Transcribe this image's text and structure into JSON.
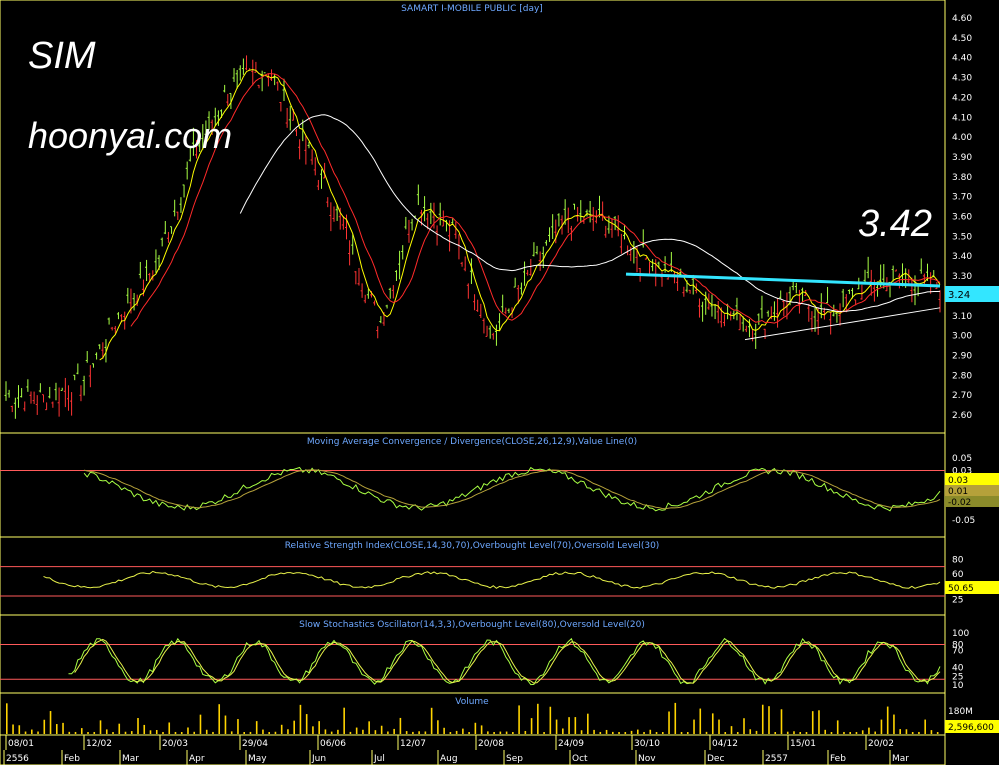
{
  "symbol_overlay": "SIM",
  "site_overlay": "hoonyai.com",
  "price_overlay": "3.42",
  "colors": {
    "background": "#000000",
    "panel_border": "#ffff66",
    "title_text": "#6ea8ff",
    "axis_text": "#ffffff",
    "candles": "#a8ff44",
    "candles_down": "#ff3333",
    "ma_fast": "#ffff00",
    "ma_mid": "#ff2a2a",
    "ma_slow": "#ffffff",
    "resistance_line": "#33e6ff",
    "macd_line": "#a8ff44",
    "signal_line": "#b5a13a",
    "rsi_line": "#e8f24a",
    "level_line": "#ff5a5a",
    "volume_bar": "#ffd400"
  },
  "chart_data": [
    {
      "type": "candlestick",
      "title": "SAMART I-MOBILE PUBLIC [day]",
      "y_ticks": [
        "4.60",
        "4.50",
        "4.40",
        "4.30",
        "4.20",
        "4.10",
        "4.00",
        "3.90",
        "3.80",
        "3.70",
        "3.60",
        "3.50",
        "3.40",
        "3.30",
        "3.20",
        "3.10",
        "3.00",
        "2.90",
        "2.80",
        "2.70",
        "2.60"
      ],
      "ylim": [
        2.55,
        4.65
      ],
      "last_value_label": "3.24",
      "close_series_anchors": [
        [
          "08/01",
          2.7
        ],
        [
          "Feb",
          2.68
        ],
        [
          "12/02",
          2.75
        ],
        [
          "Mar",
          3.1
        ],
        [
          "20/03",
          3.35
        ],
        [
          "Apr",
          3.9
        ],
        [
          "29/04",
          4.25
        ],
        [
          "May",
          4.35
        ],
        [
          "06/06",
          3.95
        ],
        [
          "Jun",
          3.55
        ],
        [
          "Jul",
          3.05
        ],
        [
          "12/07",
          3.7
        ],
        [
          "Aug",
          3.5
        ],
        [
          "20/08",
          3.0
        ],
        [
          "Sep",
          3.3
        ],
        [
          "24/09",
          3.6
        ],
        [
          "Oct",
          3.58
        ],
        [
          "30/10",
          3.4
        ],
        [
          "Nov",
          3.28
        ],
        [
          "04/12",
          3.15
        ],
        [
          "Dec",
          3.05
        ],
        [
          "2557",
          3.2
        ],
        [
          "15/01",
          3.1
        ],
        [
          "Feb",
          3.25
        ],
        [
          "20/02",
          3.3
        ],
        [
          "Mar",
          3.24
        ]
      ],
      "overlays": [
        "moving average (fast)",
        "moving average (mid)",
        "moving average (slow)",
        "resistance line",
        "support trendline"
      ]
    },
    {
      "type": "line",
      "title": "Moving Average Convergence / Divergence(CLOSE,26,12,9),Value Line(0)",
      "y_ticks": [
        "0.05",
        "0.03",
        "0.01",
        "-0.02",
        "-0.05"
      ],
      "value_labels": [
        "0.03",
        "0.01",
        "-0.02"
      ],
      "ylim": [
        -0.05,
        0.06
      ]
    },
    {
      "type": "line",
      "title": "Relative Strength Index(CLOSE,14,30,70),Overbought Level(70),Oversold Level(30)",
      "y_ticks": [
        "80",
        "60",
        "40",
        "25"
      ],
      "value_label": "50.65",
      "levels": [
        70,
        30
      ],
      "ylim": [
        15,
        90
      ]
    },
    {
      "type": "line",
      "title": "Slow Stochastics Oscillator(14,3,3),Overbought Level(80),Oversold Level(20)",
      "y_ticks": [
        "100",
        "80",
        "70",
        "40",
        "25",
        "10"
      ],
      "levels": [
        80,
        20
      ],
      "ylim": [
        5,
        105
      ]
    },
    {
      "type": "bar",
      "title": "Volume",
      "y_ticks": [
        "180M"
      ],
      "value_label": "2,596,600"
    }
  ],
  "x_axis": {
    "top_row": [
      "08/01",
      "12/02",
      "20/03",
      "29/04",
      "06/06",
      "12/07",
      "20/08",
      "24/09",
      "30/10",
      "04/12",
      "15/01",
      "20/02"
    ],
    "bottom_row": [
      "2556",
      "Feb",
      "Mar",
      "Apr",
      "May",
      "Jun",
      "Jul",
      "Aug",
      "Sep",
      "Oct",
      "Nov",
      "Dec",
      "2557",
      "Feb",
      "Mar"
    ]
  }
}
